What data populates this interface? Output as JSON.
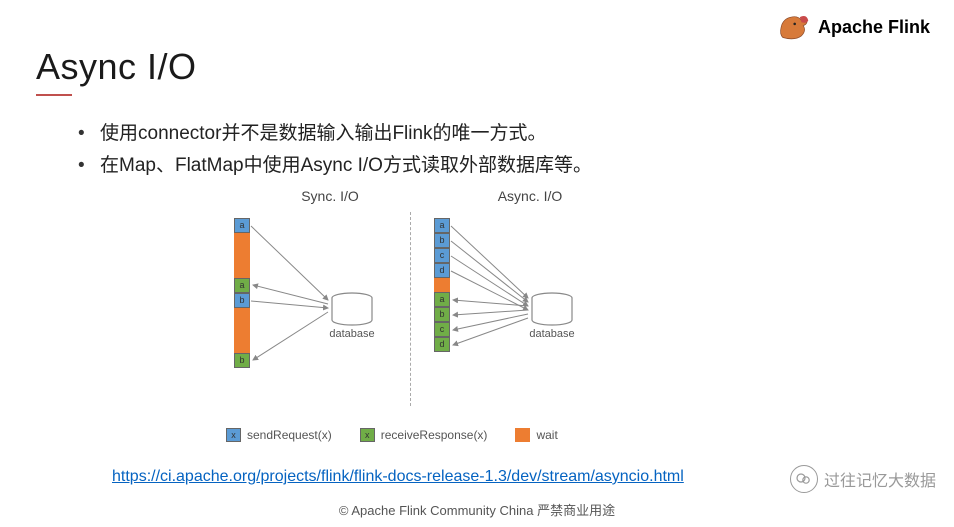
{
  "brand": {
    "name": "Apache Flink"
  },
  "title": "Async I/O",
  "bullets": [
    "使用connector并不是数据输入输出Flink的唯一方式。",
    "在Map、FlatMap中使用Async I/O方式读取外部数据库等。"
  ],
  "diagram": {
    "sync_label": "Sync. I/O",
    "async_label": "Async. I/O",
    "db_label": "database",
    "sync_stack": [
      {
        "t": "blue",
        "v": "a"
      },
      {
        "t": "orange",
        "h": "tall",
        "v": ""
      },
      {
        "t": "green",
        "v": "a"
      },
      {
        "t": "blue",
        "v": "b"
      },
      {
        "t": "orange",
        "h": "tall",
        "v": ""
      },
      {
        "t": "green",
        "v": "b"
      }
    ],
    "async_stack": [
      {
        "t": "blue",
        "v": "a"
      },
      {
        "t": "blue",
        "v": "b"
      },
      {
        "t": "blue",
        "v": "c"
      },
      {
        "t": "blue",
        "v": "d"
      },
      {
        "t": "orange",
        "h": "med",
        "v": ""
      },
      {
        "t": "green",
        "v": "a"
      },
      {
        "t": "green",
        "v": "b"
      },
      {
        "t": "green",
        "v": "c"
      },
      {
        "t": "green",
        "v": "d"
      }
    ]
  },
  "legend": {
    "send": {
      "box": "x",
      "label": "sendRequest(x)"
    },
    "recv": {
      "box": "x",
      "label": "receiveResponse(x)"
    },
    "wait": {
      "label": "wait"
    }
  },
  "link": "https://ci.apache.org/projects/flink/flink-docs-release-1.3/dev/stream/asyncio.html",
  "footer": "© Apache Flink Community China  严禁商业用途",
  "watermark": "过往记忆大数据"
}
